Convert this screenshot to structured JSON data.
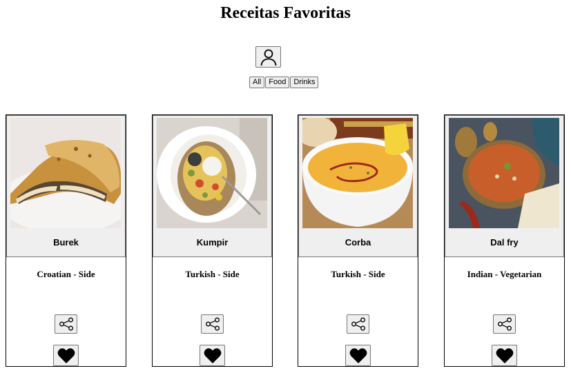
{
  "header": {
    "title": "Receitas Favoritas",
    "profile_icon": "user-icon"
  },
  "filters": {
    "all": "All",
    "food": "Food",
    "drinks": "Drinks"
  },
  "recipes": [
    {
      "name": "Burek",
      "category": "Croatian - Side",
      "image": "burek-photo"
    },
    {
      "name": "Kumpir",
      "category": "Turkish - Side",
      "image": "kumpir-photo"
    },
    {
      "name": "Corba",
      "category": "Turkish - Side",
      "image": "corba-photo"
    },
    {
      "name": "Dal fry",
      "category": "Indian - Vegetarian",
      "image": "dal-fry-photo"
    }
  ],
  "icons": {
    "share": "share-icon",
    "favorite": "heart-icon"
  }
}
